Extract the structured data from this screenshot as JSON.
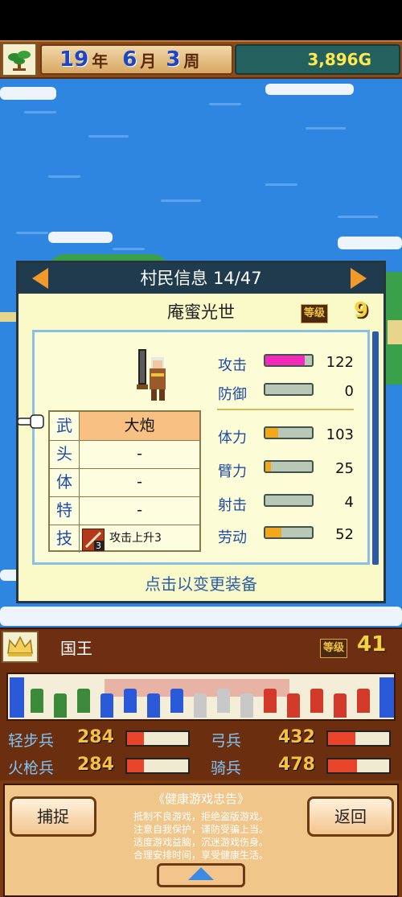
{
  "header": {
    "year": "19",
    "year_unit": "年",
    "month": "6",
    "month_unit": "月",
    "week": "3",
    "week_unit": "周",
    "gold": "3,896G"
  },
  "villager_panel": {
    "title": "村民信息 14/47",
    "name": "庵蜜光世",
    "level_label": "等级",
    "level": "9",
    "equipment": [
      {
        "category": "武",
        "value": "大炮",
        "selected": true
      },
      {
        "category": "头",
        "value": "-"
      },
      {
        "category": "体",
        "value": "-"
      },
      {
        "category": "特",
        "value": "-"
      },
      {
        "category": "技",
        "value": "攻击上升3",
        "skill_badge": "3"
      }
    ],
    "stats": [
      {
        "label": "攻击",
        "value": "122",
        "fill": 0.85,
        "color": "#ef2bb8"
      },
      {
        "label": "防御",
        "value": "0",
        "fill": 0.0,
        "color": "#f2a81c"
      },
      {
        "label": "体力",
        "value": "103",
        "fill": 0.28,
        "color": "#f2a81c"
      },
      {
        "label": "臂力",
        "value": "25",
        "fill": 0.12,
        "color": "#f2a81c"
      },
      {
        "label": "射击",
        "value": "4",
        "fill": 0.0,
        "color": "#f2a81c"
      },
      {
        "label": "劳动",
        "value": "52",
        "fill": 0.35,
        "color": "#f2a81c"
      }
    ],
    "change_hint": "点击以变更装备"
  },
  "king": {
    "name": "国王",
    "level_label": "等级",
    "level": "41"
  },
  "troops": [
    {
      "label": "轻步兵",
      "count": "284",
      "fill": 0.28
    },
    {
      "label": "火枪兵",
      "count": "284",
      "fill": 0.28
    },
    {
      "label": "弓兵",
      "count": "432",
      "fill": 0.45
    },
    {
      "label": "骑兵",
      "count": "478",
      "fill": 0.48
    }
  ],
  "bottom": {
    "capture_label": "捕捉",
    "back_label": "返回",
    "notice_title": "《健康游戏忠告》",
    "notice_lines": [
      "抵制不良游戏，拒绝盗版游戏。",
      "注意自我保护，谨防受骗上当。",
      "适度游戏益脑，沉迷游戏伤身。",
      "合理安排时间，享受健康生活。"
    ]
  },
  "icons": {
    "menu": "bonsai-tree-icon",
    "prev": "arrow-left-icon",
    "next": "arrow-right-icon",
    "pointer": "pointing-hand-icon",
    "king": "crown-icon",
    "expand": "arrow-up-icon"
  },
  "colors": {
    "accent_blue": "#1e4aa8",
    "panel_header": "#1f3b4d",
    "gold_text": "#ffe94d",
    "troop_bar": "#e8442a"
  }
}
